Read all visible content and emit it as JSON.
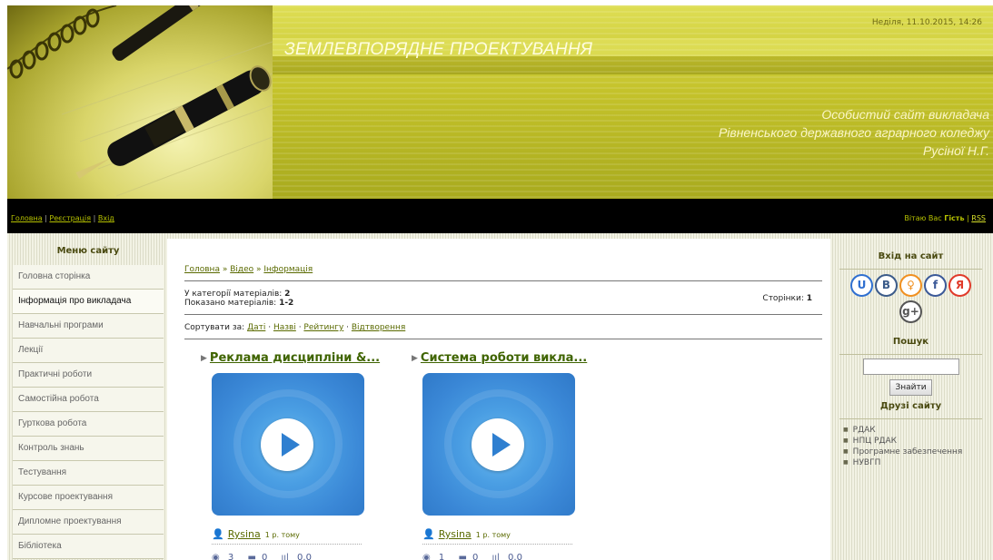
{
  "header": {
    "date": "Неділя, 11.10.2015, 14:26",
    "site_title": "ЗЕМЛЕВПОРЯДНЕ ПРОЕКТУВАННЯ",
    "subtitle_lines": [
      "Особистий сайт викладача",
      "Рівненського державного аграрного коледжу",
      "Русіної Н.Г."
    ]
  },
  "navbar": {
    "links": [
      "Головна",
      "Реєстрація",
      "Вхід"
    ],
    "greeting_prefix": "Вітаю Вас",
    "greeting_user": "Гість",
    "rss": "RSS"
  },
  "menu": {
    "title": "Меню сайту",
    "items": [
      "Головна сторінка",
      "Інформація про викладача",
      "Навчальні програми",
      "Лекції",
      "Практичні роботи",
      "Самостійна робота",
      "Гурткова робота",
      "Контроль знань",
      "Тестування",
      "Курсове проектування",
      "Дипломне проектування",
      "Бібліотека"
    ],
    "active_index": 1
  },
  "main": {
    "breadcrumb": [
      "Головна",
      "Відео",
      "Інформація"
    ],
    "category_count_label": "У категорії матеріалів:",
    "category_count": "2",
    "shown_label": "Показано матеріалів:",
    "shown_range": "1-2",
    "pages_label": "Сторінки:",
    "pages_value": "1",
    "sort_label": "Сортувати за:",
    "sort_options": [
      "Даті",
      "Назві",
      "Рейтингу",
      "Відтворення"
    ],
    "videos": [
      {
        "title": "Реклама дисципліни &...",
        "author": "Rysina",
        "ago": "1 р. тому",
        "views": "3",
        "comments": "0",
        "rating": "0.0"
      },
      {
        "title": "Система роботи викла...",
        "author": "Rysina",
        "ago": "1 р. тому",
        "views": "1",
        "comments": "0",
        "rating": "0.0"
      }
    ]
  },
  "sidebar_right": {
    "login_title": "Вхід на сайт",
    "socials": [
      {
        "name": "ucoz",
        "glyph": "U",
        "color": "#2f6fd0"
      },
      {
        "name": "vkontakte",
        "glyph": "B",
        "color": "#3b5b8a"
      },
      {
        "name": "odnoklassniki",
        "glyph": "♀",
        "color": "#f09020"
      },
      {
        "name": "facebook",
        "glyph": "f",
        "color": "#3b5998"
      },
      {
        "name": "yandex",
        "glyph": "Я",
        "color": "#e03a2a"
      },
      {
        "name": "google-plus",
        "glyph": "g+",
        "color": "#555555"
      }
    ],
    "search_title": "Пошук",
    "search_button": "Знайти",
    "friends_title": "Друзі сайту",
    "friends": [
      "РДАК",
      "НПЦ РДАК",
      "Програмне забезпечення",
      "НУВГП"
    ]
  }
}
